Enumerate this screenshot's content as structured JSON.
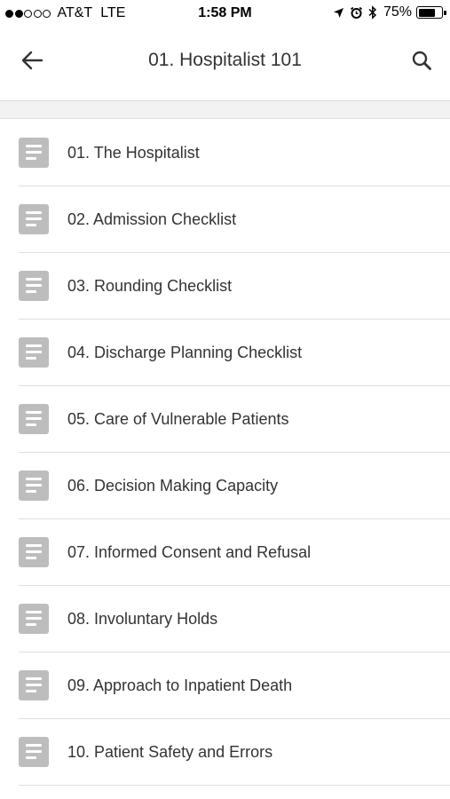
{
  "status_bar": {
    "carrier": "AT&T",
    "network": "LTE",
    "time": "1:58 PM",
    "battery_percent": "75%",
    "battery_level": 0.75,
    "signal_bars_filled": 2,
    "signal_bars_total": 5
  },
  "header": {
    "title": "01. Hospitalist 101",
    "back_icon": "arrow-left-icon",
    "search_icon": "search-icon"
  },
  "list": {
    "items": [
      {
        "label": "01. The Hospitalist",
        "icon": "document-icon"
      },
      {
        "label": "02. Admission Checklist",
        "icon": "document-icon"
      },
      {
        "label": "03. Rounding Checklist",
        "icon": "document-icon"
      },
      {
        "label": "04. Discharge Planning Checklist",
        "icon": "document-icon"
      },
      {
        "label": "05. Care of Vulnerable Patients",
        "icon": "document-icon"
      },
      {
        "label": "06. Decision Making Capacity",
        "icon": "document-icon"
      },
      {
        "label": "07. Informed Consent and Refusal",
        "icon": "document-icon"
      },
      {
        "label": "08. Involuntary Holds",
        "icon": "document-icon"
      },
      {
        "label": "09. Approach to Inpatient Death",
        "icon": "document-icon"
      },
      {
        "label": "10. Patient Safety and Errors",
        "icon": "document-icon"
      }
    ]
  },
  "colors": {
    "text": "#333333",
    "icon_background": "#bdbdbd",
    "divider": "#dedede",
    "band": "#f2f2f2"
  }
}
